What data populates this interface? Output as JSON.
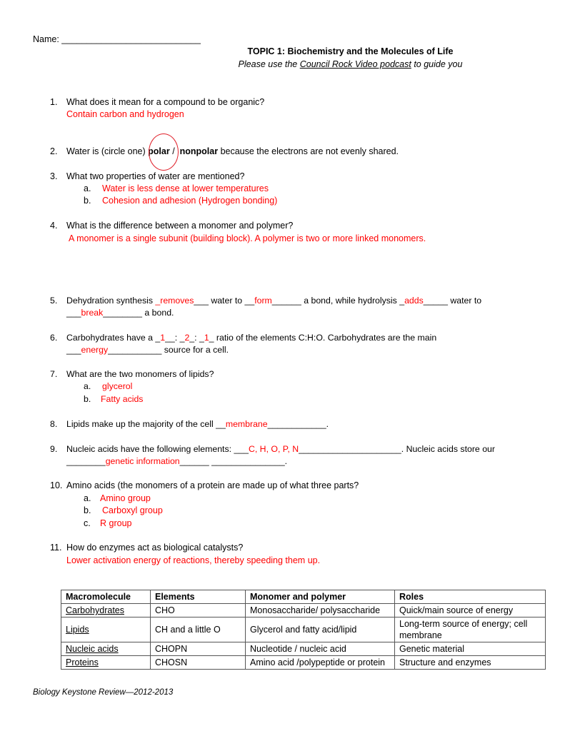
{
  "header": {
    "name_label": "Name: ____________________________",
    "title": "TOPIC 1: Biochemistry and the Molecules of Life",
    "subtitle_prefix": "Please use the ",
    "subtitle_link": "Council Rock Video podcast",
    "subtitle_suffix": " to guide you"
  },
  "questions": {
    "q1": {
      "num": "1.",
      "text": "What does it mean for a compound to be organic?",
      "answer": "Contain carbon and hydrogen"
    },
    "q2": {
      "num": "2.",
      "text_before": "Water is (circle one) ",
      "opt1": "polar",
      "sep": " /  ",
      "opt2": "nonpolar",
      "text_after": " because the electrons are not evenly shared."
    },
    "q3": {
      "num": "3.",
      "text": "What two properties of water are mentioned?",
      "a_label": "a.",
      "a": "Water is less dense at lower temperatures",
      "b_label": "b.",
      "b": "Cohesion and adhesion (Hydrogen bonding)"
    },
    "q4": {
      "num": "4.",
      "text": "What is the difference between a monomer and polymer?",
      "answer": "A monomer is a single subunit (building block).  A polymer is two or more linked monomers."
    },
    "q5": {
      "num": "5.",
      "t1": "Dehydration synthesis ",
      "a1": "_removes",
      "t2": "___ water to __",
      "a2": "form",
      "t3": "______ a bond, while hydrolysis _",
      "a3": "adds",
      "t4": "_____ water to",
      "t5": "___",
      "a4": "break",
      "t6": "________ a bond."
    },
    "q6": {
      "num": "6.",
      "t1": "Carbohydrates have a _",
      "a1": "1",
      "t2": "__: _",
      "a2": "2",
      "t3": "_: _",
      "a3": "1",
      "t4": "_ ratio of the elements C:H:O. Carbohydrates are the main",
      "t5": "___",
      "a4": "energy",
      "t6": "___________ source for a cell."
    },
    "q7": {
      "num": "7.",
      "text": "What are the two monomers of lipids?",
      "a_label": "a.",
      "a": "glycerol",
      "b_label": "b.",
      "b": "Fatty acids"
    },
    "q8": {
      "num": "8.",
      "t1": "Lipids make up the majority of the cell __",
      "a1": "membrane",
      "t2": "____________."
    },
    "q9": {
      "num": "9.",
      "t1": "Nucleic acids have the following elements: ___",
      "a1": "C, H, O, P, N",
      "t2": "_____________________. Nucleic acids store our",
      "t3": "________",
      "a2": "genetic information",
      "t4": "______  _______________."
    },
    "q10": {
      "num": "10.",
      "text": "Amino acids (the monomers of a protein are made up of what three parts?",
      "a_label": "a.",
      "a": "Amino group",
      "b_label": "b.",
      "b": "Carboxyl group",
      "c_label": "c.",
      "c": "R group"
    },
    "q11": {
      "num": "11.",
      "text": "How do enzymes act as biological catalysts?",
      "answer": "Lower activation energy of reactions, thereby speeding them up."
    }
  },
  "table": {
    "headers": [
      "Macromolecule",
      "Elements",
      "Monomer and polymer",
      "Roles"
    ],
    "rows": [
      [
        "Carbohydrates",
        "CHO",
        "Monosaccharide/ polysaccharide",
        "Quick/main source of energy"
      ],
      [
        "Lipids",
        "CH and a little O",
        "Glycerol and fatty acid/lipid",
        "Long-term source of energy; cell membrane"
      ],
      [
        "Nucleic acids",
        "CHOPN",
        "Nucleotide / nucleic acid",
        "Genetic material"
      ],
      [
        "Proteins",
        "CHOSN",
        "Amino acid /polypeptide or protein",
        "Structure and enzymes"
      ]
    ]
  },
  "footer": {
    "text": "Biology Keystone Review—2012-2013"
  },
  "colors": {
    "answer": "#ff0000",
    "circle": "#e0202a"
  }
}
